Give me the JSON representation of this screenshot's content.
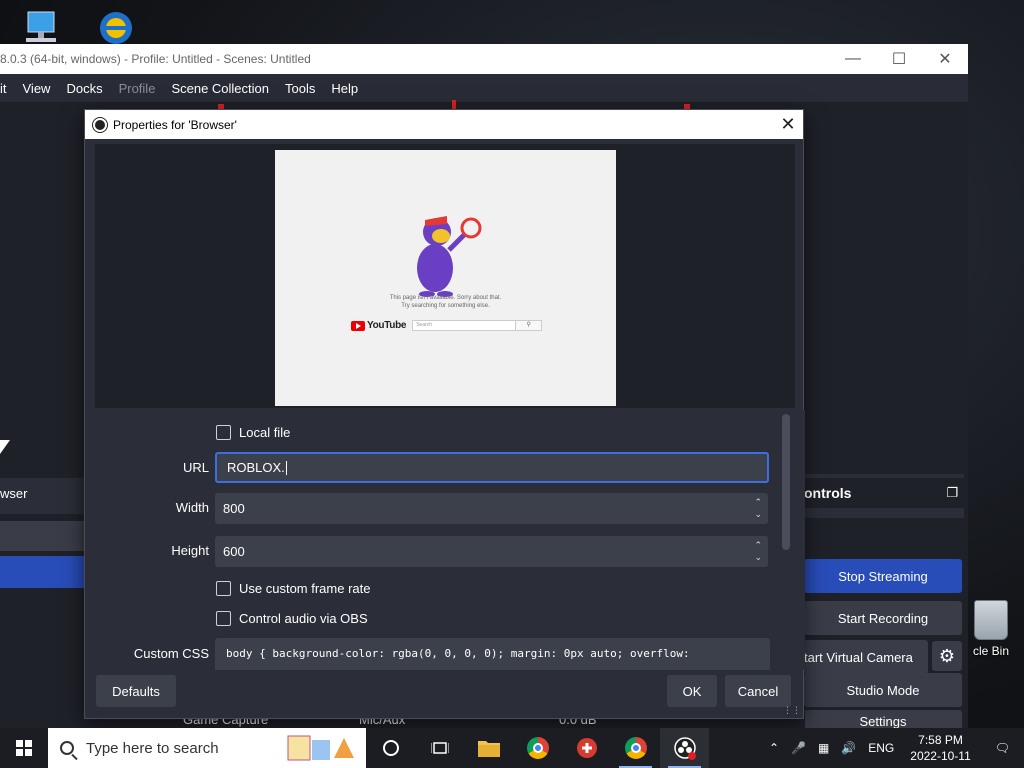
{
  "desktop": {
    "recycle_bin_label": "cle Bin"
  },
  "obs": {
    "title": "8.0.3 (64-bit, windows) - Profile: Untitled - Scenes: Untitled",
    "menu": [
      {
        "label": "it",
        "disabled": false
      },
      {
        "label": "View",
        "disabled": false
      },
      {
        "label": "Docks",
        "disabled": false
      },
      {
        "label": "Profile",
        "disabled": true
      },
      {
        "label": "Scene Collection",
        "disabled": false
      },
      {
        "label": "Tools",
        "disabled": false
      },
      {
        "label": "Help",
        "disabled": false
      }
    ],
    "left_source_label": "wser",
    "controls_title": "ontrols",
    "controls": {
      "stop_streaming": "Stop Streaming",
      "start_recording": "Start Recording",
      "start_virtual_camera": "tart Virtual Camera",
      "studio_mode": "Studio Mode",
      "settings": "Settings"
    },
    "behind": {
      "game_capture": "Game Capture",
      "mic_aux": "Mic/Aux",
      "db": "0.0 dB"
    }
  },
  "dialog": {
    "title": "Properties for 'Browser'",
    "preview": {
      "error_line1": "This page isn't available. Sorry about that.",
      "error_line2": "Try searching for something else.",
      "youtube": "YouTube",
      "search_placeholder": "Search"
    },
    "local_file_label": "Local file",
    "url_label": "URL",
    "url_value": "ROBLOX.",
    "width_label": "Width",
    "width_value": "800",
    "height_label": "Height",
    "height_value": "600",
    "custom_frame_rate_label": "Use custom frame rate",
    "control_audio_label": "Control audio via OBS",
    "custom_css_label": "Custom CSS",
    "custom_css_value": "body { background-color: rgba(0, 0, 0, 0); margin: 0px auto; overflow:",
    "defaults_button": "Defaults",
    "ok_button": "OK",
    "cancel_button": "Cancel"
  },
  "taskbar": {
    "search_placeholder": "Type here to search",
    "language": "ENG",
    "time": "7:58 PM",
    "date": "2022-10-11"
  },
  "colors": {
    "accent": "#284cb8",
    "focus": "#3e6fe0",
    "panel": "#2b2e38",
    "input": "#3c404b"
  }
}
